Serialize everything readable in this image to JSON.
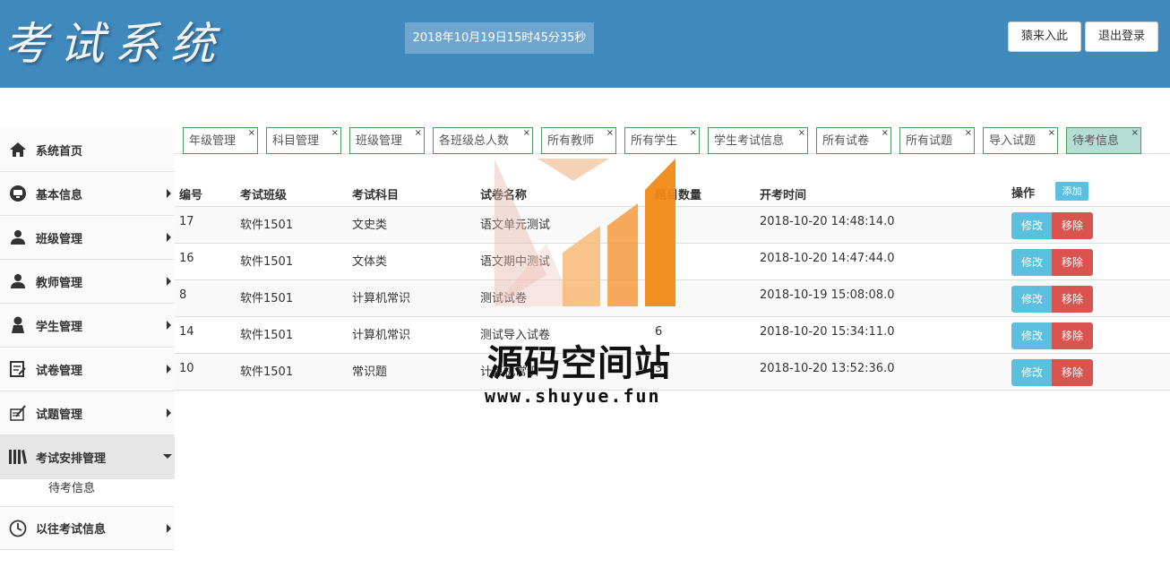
{
  "header": {
    "logo": "考试系统",
    "datetime": "2018年10月19日15时45分35秒",
    "home_button": "猿来入此",
    "logout_button": "退出登录"
  },
  "sidebar": {
    "items": [
      {
        "label": "系统首页",
        "icon": "home-icon"
      },
      {
        "label": "基本信息",
        "icon": "info-icon"
      },
      {
        "label": "班级管理",
        "icon": "user-icon"
      },
      {
        "label": "教师管理",
        "icon": "user-icon"
      },
      {
        "label": "学生管理",
        "icon": "user-icon"
      },
      {
        "label": "试卷管理",
        "icon": "edit-icon"
      },
      {
        "label": "试题管理",
        "icon": "paper-icon"
      },
      {
        "label": "考试安排管理",
        "icon": "books-icon"
      },
      {
        "label": "以往考试信息",
        "icon": "clock-icon"
      }
    ],
    "sub_item": "待考信息"
  },
  "tabs": [
    "年级管理",
    "科目管理",
    "班级管理",
    "各班级总人数",
    "所有教师",
    "所有学生",
    "学生考试信息",
    "所有试卷",
    "所有试题",
    "导入试题",
    "待考信息"
  ],
  "tab_close": "×",
  "table": {
    "headers": [
      "编号",
      "考试班级",
      "考试科目",
      "试卷名称",
      "题目数量",
      "开考时间",
      "操作"
    ],
    "add_button": "添加",
    "edit_button": "修改",
    "delete_button": "移除",
    "rows": [
      {
        "id": "17",
        "class": "软件1501",
        "subject": "文史类",
        "paper": "语文单元测试",
        "count": "",
        "time": "2018-10-20 14:48:14.0"
      },
      {
        "id": "16",
        "class": "软件1501",
        "subject": "文体类",
        "paper": "语文期中测试",
        "count": "",
        "time": "2018-10-20 14:47:44.0"
      },
      {
        "id": "8",
        "class": "软件1501",
        "subject": "计算机常识",
        "paper": "测试试卷",
        "count": "",
        "time": "2018-10-19 15:08:08.0"
      },
      {
        "id": "14",
        "class": "软件1501",
        "subject": "计算机常识",
        "paper": "测试导入试卷",
        "count": "6",
        "time": "2018-10-20 15:34:11.0"
      },
      {
        "id": "10",
        "class": "软件1501",
        "subject": "常识题",
        "paper": "计算机常识",
        "count": "3",
        "time": "2018-10-20 13:52:36.0"
      }
    ]
  },
  "watermark": {
    "text": "源码空间站",
    "url": "www.shuyue.fun"
  }
}
